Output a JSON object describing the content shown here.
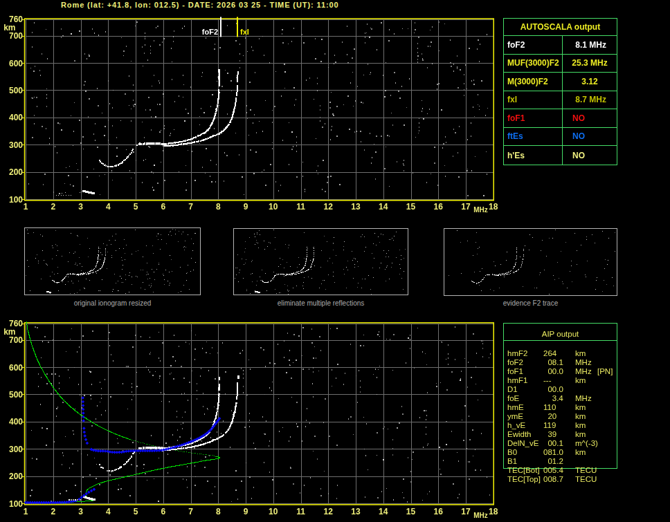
{
  "header": {
    "title": "Rome (lat: +41.8, lon: 012.5) - DATE: 2026 03 25 - TIME (UT): 11:00"
  },
  "colors": {
    "background": "#000000",
    "frame_yellow": "#f2f200",
    "grid_gray": "#6e6e6e",
    "axis_label": "#efef7a",
    "trace_white": "#ffffff",
    "profile_green": "#00dd00",
    "trace_blue": "#0a0af0",
    "table_border_green": "#44dd66",
    "table_header_yellow": "#eded24",
    "bright_yellow": "#eded24",
    "dim_yellow": "#c2c200",
    "pale_yellow": "#f0f080",
    "red": "#f01010",
    "blue_text": "#0d6ef0",
    "white": "#ffffff",
    "aip_text": "#e9e961",
    "thumb_border": "#b4b4b4",
    "caption_gray": "#ababab"
  },
  "autoscala_table": {
    "title": "AUTOSCALA output",
    "rows": [
      {
        "label": "foF2",
        "value": " 8.1 MHz",
        "color": "#ffffff",
        "left": false
      },
      {
        "label": "MUF(3000)F2",
        "value": "25.3 MHz",
        "color": "#eded24",
        "left": false
      },
      {
        "label": "M(3000)F2",
        "value": "3.12",
        "color": "#eded24",
        "left": false
      },
      {
        "label": "fxI",
        "value": " 8.7 MHz",
        "color": "#c2c200",
        "left": false
      },
      {
        "label": "foF1",
        "value": "NO",
        "color": "#f01010",
        "left": true
      },
      {
        "label": "ftEs",
        "value": "NO",
        "color": "#0d6ef0",
        "left": true
      },
      {
        "label": "h'Es",
        "value": "NO",
        "color": "#f0f080",
        "left": true
      }
    ]
  },
  "aip_table": {
    "title": "AIP output",
    "rows": [
      {
        "param": "hmF2",
        "value": "264",
        "unit": "km",
        "note": ""
      },
      {
        "param": "foF2",
        "value": "  08.1",
        "unit": "MHz",
        "note": ""
      },
      {
        "param": "foF1",
        "value": "  00.0",
        "unit": "MHz",
        "note": "[PN]"
      },
      {
        "param": "hmF1",
        "value": "---",
        "unit": "km",
        "note": ""
      },
      {
        "param": "D1",
        "value": "  00.0",
        "unit": "",
        "note": ""
      },
      {
        "param": "foE",
        "value": "    3.4",
        "unit": "MHz",
        "note": ""
      },
      {
        "param": "hmE",
        "value": "110",
        "unit": "km",
        "note": ""
      },
      {
        "param": "ymE",
        "value": "  20",
        "unit": "km",
        "note": ""
      },
      {
        "param": "h_vE",
        "value": "119",
        "unit": "km",
        "note": ""
      },
      {
        "param": "Ewidth",
        "value": "  39",
        "unit": "km",
        "note": ""
      },
      {
        "param": "DelN_vE",
        "value": "  00.1",
        "unit": "m^(-3)",
        "note": ""
      },
      {
        "param": "B0",
        "value": "081.0",
        "unit": "km",
        "note": ""
      },
      {
        "param": "B1",
        "value": "  01.2",
        "unit": "",
        "note": ""
      },
      {
        "param": "TEC[Bot]",
        "value": "005.4",
        "unit": "TECU",
        "note": ""
      },
      {
        "param": "TEC[Top]",
        "value": "008.7",
        "unit": "TECU",
        "note": ""
      }
    ]
  },
  "thumbnails": [
    {
      "caption": "original ionogram resized",
      "noise": 210,
      "seed": 7,
      "full": true
    },
    {
      "caption": "eliminate multiple reflections",
      "noise": 195,
      "seed": 8,
      "full": true
    },
    {
      "caption": "evidence F2 trace",
      "noise": 85,
      "seed": 9,
      "full": false
    }
  ],
  "chart_data": [
    {
      "id": "top_ionogram",
      "type": "scatter",
      "xlabel": "MHz",
      "ylabel": "km",
      "xlim": [
        1,
        18
      ],
      "ylim": [
        100,
        760
      ],
      "xticks": [
        1,
        2,
        3,
        4,
        5,
        6,
        7,
        8,
        9,
        10,
        11,
        12,
        13,
        14,
        15,
        16,
        17,
        18
      ],
      "yticks": [
        100,
        200,
        300,
        400,
        500,
        600,
        700,
        760
      ],
      "grid": true,
      "markers": [
        {
          "label": "foF2",
          "f": 8.1,
          "color": "#ffffff",
          "side": "left"
        },
        {
          "label": "fxI",
          "f": 8.7,
          "color": "#f2f200",
          "side": "right"
        }
      ],
      "noise": {
        "seed": 41,
        "dots": 480,
        "columns": 16,
        "bright": 14
      }
    },
    {
      "id": "bottom_ionogram",
      "type": "scatter",
      "xlabel": "MHz",
      "ylabel": "km",
      "xlim": [
        1,
        18
      ],
      "ylim": [
        100,
        760
      ],
      "xticks": [
        1,
        2,
        3,
        4,
        5,
        6,
        7,
        8,
        9,
        10,
        11,
        12,
        13,
        14,
        15,
        16,
        17,
        18
      ],
      "yticks": [
        100,
        200,
        300,
        400,
        500,
        600,
        700,
        760
      ],
      "grid": true,
      "markers": [],
      "noise": {
        "seed": 97,
        "dots": 440,
        "columns": 14,
        "bright": 12
      }
    }
  ],
  "traces": {
    "o_dip": [
      [
        3.68,
        243
      ],
      [
        3.72,
        237
      ],
      [
        3.78,
        231
      ],
      [
        3.85,
        226
      ],
      [
        3.93,
        222
      ],
      [
        4.03,
        219
      ],
      [
        4.13,
        219
      ],
      [
        4.24,
        221
      ],
      [
        4.36,
        226
      ],
      [
        4.47,
        232
      ],
      [
        4.57,
        240
      ],
      [
        4.66,
        249
      ],
      [
        4.74,
        258
      ],
      [
        4.81,
        267
      ],
      [
        4.87,
        276
      ],
      [
        4.93,
        286
      ],
      [
        5.0,
        294
      ],
      [
        5.08,
        300
      ]
    ],
    "o_flat": [
      [
        5.12,
        302
      ],
      [
        5.3,
        303
      ],
      [
        5.5,
        304
      ],
      [
        5.7,
        304
      ],
      [
        5.9,
        303
      ],
      [
        6.1,
        303
      ]
    ],
    "o_main": [
      [
        6.1,
        303
      ],
      [
        6.3,
        306
      ],
      [
        6.45,
        308
      ],
      [
        6.6,
        310
      ],
      [
        6.76,
        313
      ],
      [
        6.95,
        318
      ],
      [
        7.14,
        325
      ],
      [
        7.32,
        334
      ],
      [
        7.51,
        344
      ],
      [
        7.65,
        357
      ],
      [
        7.77,
        376
      ],
      [
        7.86,
        397
      ],
      [
        7.93,
        423
      ],
      [
        7.98,
        447
      ],
      [
        8.01,
        473
      ],
      [
        8.03,
        503
      ]
    ],
    "o_sparse": [
      [
        8.04,
        520
      ],
      [
        8.05,
        536
      ],
      [
        8.04,
        551
      ],
      [
        8.05,
        566
      ],
      [
        8.03,
        575
      ]
    ],
    "x_main": [
      [
        5.95,
        294
      ],
      [
        6.1,
        295
      ],
      [
        6.3,
        297
      ],
      [
        6.5,
        299
      ],
      [
        6.7,
        301.5
      ],
      [
        6.85,
        304
      ],
      [
        7.05,
        307
      ],
      [
        7.25,
        311.5
      ],
      [
        7.45,
        316.5
      ],
      [
        7.6,
        322
      ],
      [
        7.8,
        330
      ],
      [
        8.0,
        339
      ],
      [
        8.15,
        348
      ],
      [
        8.28,
        360
      ],
      [
        8.4,
        376
      ],
      [
        8.49,
        395
      ],
      [
        8.56,
        419
      ],
      [
        8.62,
        444
      ],
      [
        8.66,
        470
      ]
    ],
    "x_sparse": [
      [
        8.68,
        487
      ],
      [
        8.69,
        503
      ],
      [
        8.7,
        519
      ],
      [
        8.7,
        536
      ],
      [
        8.71,
        552
      ],
      [
        8.73,
        568
      ]
    ],
    "es_blob_top": [
      [
        3.1,
        130
      ],
      [
        3.18,
        128
      ],
      [
        3.26,
        126
      ],
      [
        3.34,
        124
      ],
      [
        3.42,
        122
      ],
      [
        3.5,
        121
      ]
    ],
    "es_dots_top": [
      [
        2.1,
        115
      ],
      [
        2.19,
        115
      ],
      [
        2.28,
        116
      ],
      [
        2.37,
        115
      ],
      [
        2.46,
        116
      ],
      [
        2.55,
        115
      ],
      [
        2.64,
        116
      ],
      [
        2.32,
        123
      ],
      [
        2.44,
        126
      ],
      [
        2.95,
        126
      ],
      [
        3.02,
        128
      ]
    ],
    "es_blob_bottom": [
      [
        3.12,
        124
      ],
      [
        3.2,
        121
      ],
      [
        3.28,
        119
      ],
      [
        3.36,
        117
      ],
      [
        3.44,
        115
      ],
      [
        3.5,
        114
      ]
    ],
    "es_dots_bottom": [
      [
        2.56,
        114
      ],
      [
        2.63,
        115
      ],
      [
        2.7,
        114
      ],
      [
        2.78,
        115
      ],
      [
        2.86,
        116
      ],
      [
        2.95,
        115
      ]
    ],
    "green_upper": [
      [
        1.02,
        768
      ],
      [
        1.06,
        740
      ],
      [
        1.13,
        712
      ],
      [
        1.21,
        684
      ],
      [
        1.3,
        658
      ],
      [
        1.41,
        630
      ],
      [
        1.53,
        604
      ],
      [
        1.67,
        578
      ],
      [
        1.82,
        553
      ],
      [
        1.98,
        528
      ],
      [
        2.16,
        504
      ],
      [
        2.35,
        482
      ],
      [
        2.55,
        462
      ],
      [
        2.76,
        444
      ],
      [
        2.98,
        427
      ],
      [
        3.2,
        412
      ],
      [
        3.45,
        396
      ],
      [
        3.7,
        382
      ],
      [
        3.95,
        369
      ],
      [
        4.2,
        358
      ],
      [
        4.5,
        346
      ],
      [
        4.8,
        335
      ]
    ],
    "green_dotted": [
      [
        4.8,
        335
      ],
      [
        5.1,
        325
      ],
      [
        5.4,
        317
      ],
      [
        5.7,
        310
      ],
      [
        6.0,
        303
      ],
      [
        6.3,
        297
      ],
      [
        6.6,
        292
      ],
      [
        6.9,
        287
      ],
      [
        7.2,
        283
      ],
      [
        7.5,
        279
      ],
      [
        7.75,
        276
      ],
      [
        7.9,
        273
      ]
    ],
    "green_nose": [
      [
        7.9,
        273
      ],
      [
        8.0,
        271
      ],
      [
        8.05,
        269
      ],
      [
        8.0,
        266
      ],
      [
        7.9,
        264
      ]
    ],
    "green_lower": [
      [
        7.9,
        264
      ],
      [
        7.7,
        261
      ],
      [
        7.5,
        258
      ],
      [
        7.2,
        252
      ],
      [
        6.9,
        247
      ],
      [
        6.6,
        241
      ],
      [
        6.3,
        236
      ],
      [
        6.0,
        230
      ],
      [
        5.7,
        224
      ],
      [
        5.4,
        217
      ],
      [
        5.1,
        210
      ],
      [
        4.8,
        203
      ],
      [
        4.5,
        196
      ],
      [
        4.2,
        189
      ],
      [
        3.95,
        183
      ],
      [
        3.75,
        177
      ],
      [
        3.6,
        172
      ],
      [
        3.45,
        164
      ],
      [
        3.3,
        157
      ],
      [
        3.22,
        150
      ],
      [
        3.19,
        141
      ],
      [
        3.18,
        131
      ],
      [
        3.21,
        123
      ],
      [
        3.28,
        117
      ],
      [
        3.38,
        113.5
      ],
      [
        3.47,
        112
      ]
    ],
    "green_tail": [
      [
        3.47,
        112
      ],
      [
        3.35,
        110
      ],
      [
        3.2,
        109
      ],
      [
        3.0,
        108.5
      ],
      [
        2.85,
        108
      ],
      [
        2.7,
        106.5
      ],
      [
        2.55,
        104.5
      ],
      [
        2.4,
        103.5
      ],
      [
        2.25,
        103
      ]
    ],
    "blue_f_vert": [
      [
        3.08,
        487
      ],
      [
        3.09,
        452
      ],
      [
        3.1,
        416
      ],
      [
        3.11,
        390
      ],
      [
        3.13,
        363
      ],
      [
        3.16,
        345
      ],
      [
        3.2,
        331
      ],
      [
        3.24,
        320
      ],
      [
        3.28,
        311
      ],
      [
        3.33,
        304
      ],
      [
        3.39,
        298
      ]
    ],
    "blue_f": [
      [
        3.39,
        298
      ],
      [
        3.47,
        295
      ],
      [
        3.58,
        293
      ],
      [
        3.7,
        292
      ],
      [
        3.85,
        292
      ],
      [
        3.98,
        291
      ],
      [
        4.1,
        288
      ],
      [
        4.3,
        287
      ],
      [
        4.5,
        288
      ],
      [
        4.65,
        291
      ],
      [
        4.8,
        292
      ],
      [
        5.0,
        293
      ],
      [
        5.3,
        293
      ],
      [
        5.6,
        293
      ],
      [
        5.9,
        294
      ],
      [
        6.1,
        298
      ],
      [
        6.3,
        303
      ],
      [
        6.5,
        309
      ],
      [
        6.7,
        315
      ],
      [
        6.9,
        322
      ],
      [
        7.1,
        330
      ],
      [
        7.3,
        339
      ],
      [
        7.45,
        348
      ],
      [
        7.6,
        358
      ],
      [
        7.72,
        369
      ],
      [
        7.82,
        381
      ],
      [
        7.92,
        394
      ],
      [
        8.0,
        405
      ],
      [
        8.05,
        412
      ]
    ],
    "blue_e": [
      [
        1.0,
        103
      ],
      [
        1.1,
        103
      ],
      [
        1.2,
        103
      ],
      [
        1.3,
        103
      ],
      [
        1.4,
        103
      ],
      [
        1.5,
        103
      ],
      [
        1.6,
        103
      ],
      [
        1.7,
        103
      ],
      [
        1.8,
        103
      ],
      [
        1.9,
        103
      ],
      [
        2.0,
        103
      ],
      [
        2.1,
        103
      ],
      [
        2.2,
        103.5
      ],
      [
        2.3,
        103.5
      ],
      [
        2.4,
        104
      ],
      [
        2.5,
        104.5
      ],
      [
        2.6,
        105.5
      ],
      [
        2.7,
        107
      ],
      [
        2.8,
        109
      ],
      [
        2.9,
        112
      ]
    ],
    "blue_e_rise": [
      [
        2.95,
        115
      ],
      [
        3.03,
        122
      ],
      [
        3.12,
        129
      ],
      [
        3.22,
        136
      ],
      [
        3.33,
        143
      ],
      [
        3.43,
        148
      ],
      [
        3.52,
        153
      ]
    ]
  }
}
